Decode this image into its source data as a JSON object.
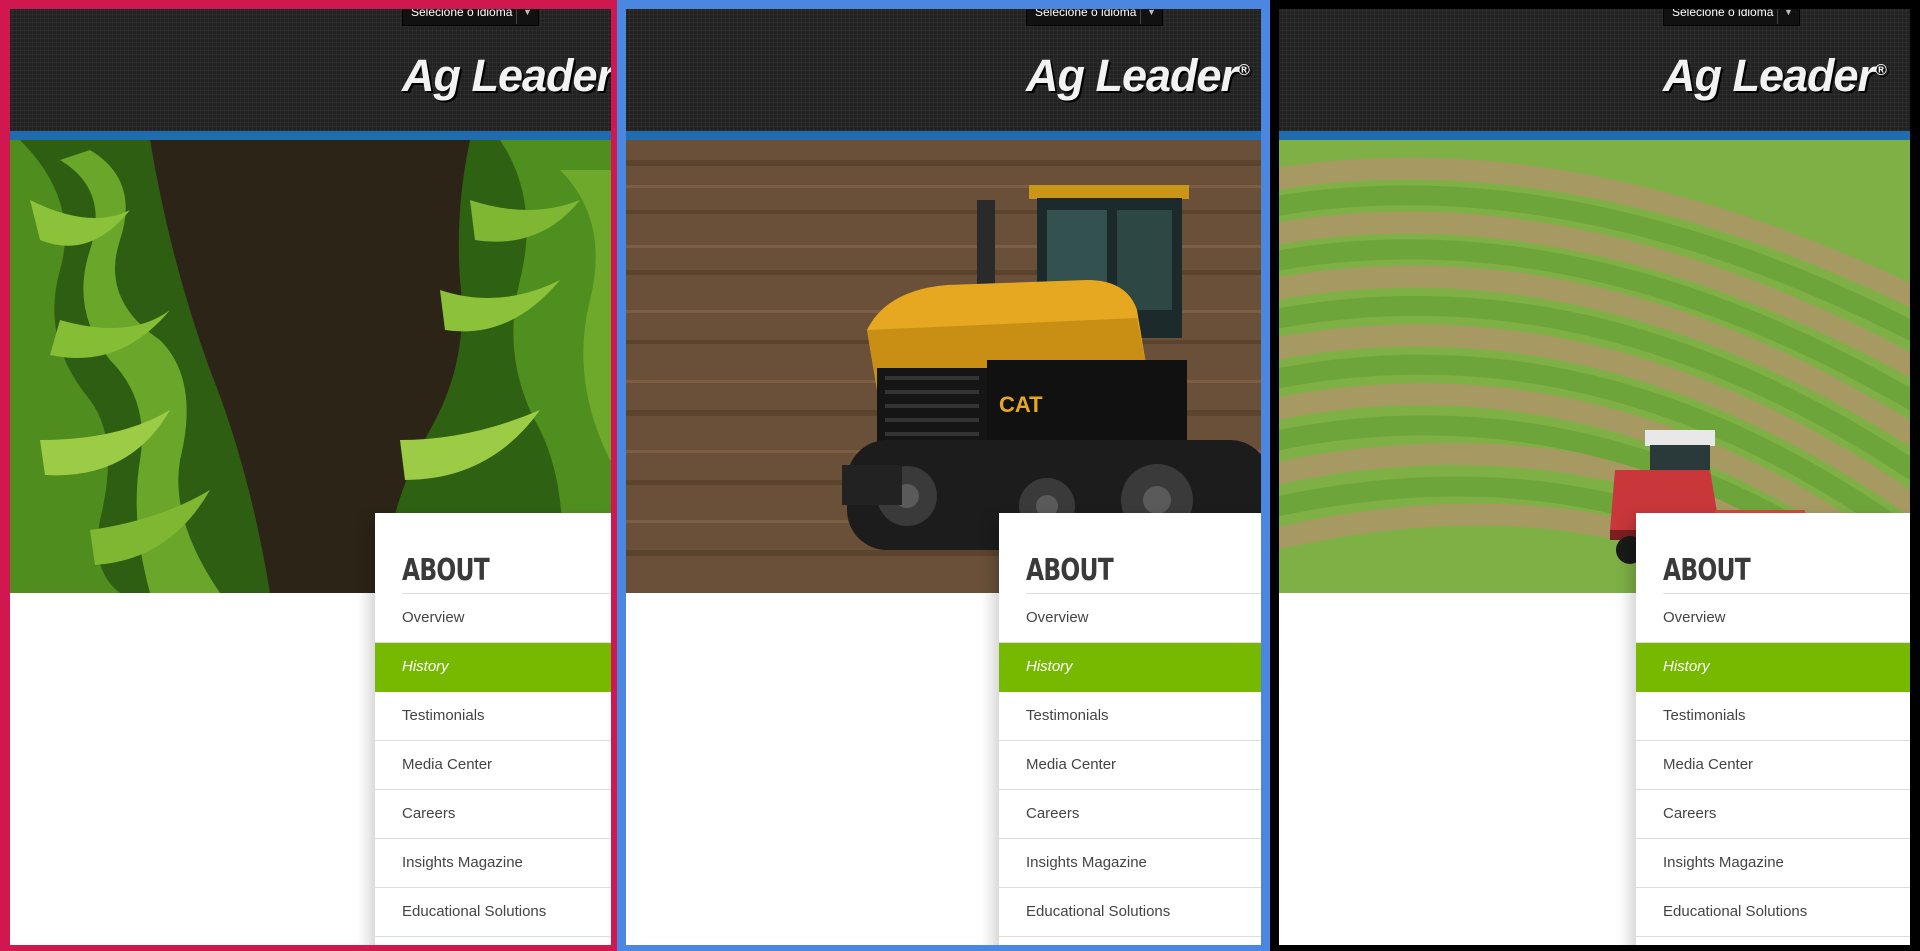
{
  "panels": [
    {
      "frame_color": "#d0174f",
      "hero": "corn-field",
      "language_select": {
        "label": "Selecione o idioma"
      },
      "logo": {
        "text": "Ag Leader",
        "mark": "®"
      },
      "nav": {
        "title": "ABOUT",
        "active_index": 1,
        "items": [
          {
            "label": "Overview"
          },
          {
            "label": "History"
          },
          {
            "label": "Testimonials"
          },
          {
            "label": "Media Center"
          },
          {
            "label": "Careers"
          },
          {
            "label": "Insights Magazine"
          },
          {
            "label": "Educational Solutions"
          }
        ]
      }
    },
    {
      "frame_color": "#1cc93a",
      "hero": "tracked-tractor-on-tilled-soil",
      "language_select": {
        "label": "Selecione o idioma"
      },
      "logo": {
        "text": "Ag Leader",
        "mark": "®"
      },
      "nav": {
        "title": "ABOUT",
        "active_index": 1,
        "items": [
          {
            "label": "Overview"
          },
          {
            "label": "History"
          },
          {
            "label": "Testimonials"
          },
          {
            "label": "Media Center"
          },
          {
            "label": "Careers"
          },
          {
            "label": "Insights Magazine"
          },
          {
            "label": "Educational Solutions"
          }
        ]
      }
    },
    {
      "frame_color": "#4b87e0",
      "hero": "windrower-in-striped-field",
      "language_select": {
        "label": "Selecione o idioma"
      },
      "logo": {
        "text": "Ag Leader",
        "mark": "®"
      },
      "nav": {
        "title": "ABOUT",
        "active_index": 1,
        "items": [
          {
            "label": "Overview"
          },
          {
            "label": "History"
          },
          {
            "label": "Testimonials"
          },
          {
            "label": "Media Center"
          },
          {
            "label": "Careers"
          },
          {
            "label": "Insights Magazine"
          },
          {
            "label": "Educational Solutions"
          }
        ]
      }
    }
  ],
  "colors": {
    "header_bg": "#222222",
    "header_rule": "#1f6cb0",
    "nav_active": "#76b900",
    "nav_text": "#444444"
  },
  "icons": {
    "dropdown_arrow": "chevron-down-icon"
  }
}
